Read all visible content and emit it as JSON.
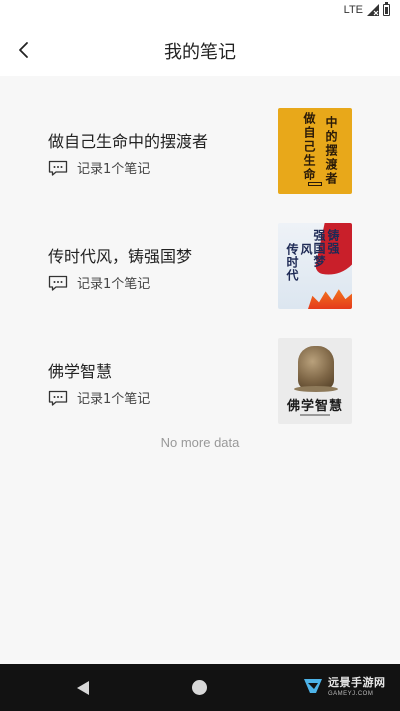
{
  "status_bar": {
    "network": "LTE"
  },
  "header": {
    "title": "我的笔记",
    "back_icon": "chevron-left-icon"
  },
  "notes": [
    {
      "title": "做自己生命中的摆渡者",
      "count_text": "记录1个笔记",
      "icon": "comment-icon",
      "cover": {
        "col_right": "中的摆渡者",
        "col_left": "做自己生命",
        "accent": "#e8a81a"
      }
    },
    {
      "title": "传时代风，铸强国梦",
      "count_text": "记录1个笔记",
      "icon": "comment-icon",
      "cover": {
        "col_a": "铸强",
        "col_b": "强国梦",
        "col_c": "传时代",
        "col_d": "风",
        "accent": "#c91f2a"
      }
    },
    {
      "title": "佛学智慧",
      "count_text": "记录1个笔记",
      "icon": "comment-icon",
      "cover": {
        "title": "佛学智慧",
        "accent": "#7d6545"
      }
    }
  ],
  "list_footer": "No more data",
  "nav_bar": {
    "back_icon": "triangle-back-icon",
    "home_icon": "circle-home-icon"
  },
  "watermark": {
    "name": "远景手游网",
    "url": "GAMEYJ.COM"
  }
}
